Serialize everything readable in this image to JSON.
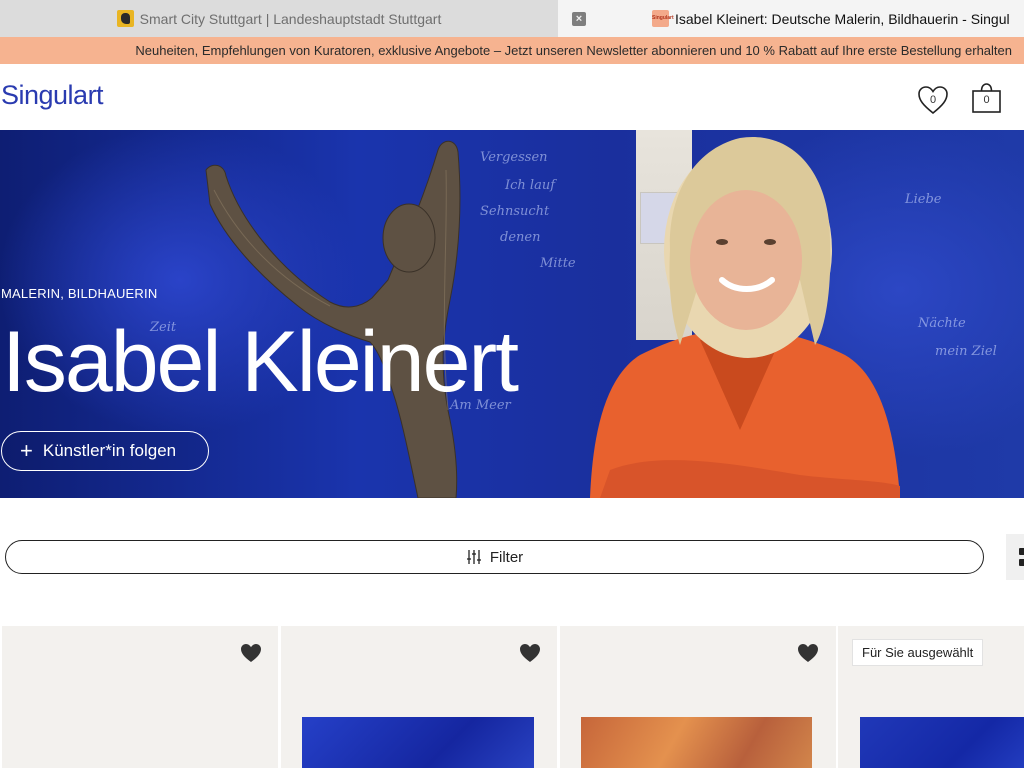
{
  "browser": {
    "tabs": [
      {
        "title": "Smart City Stuttgart | Landeshauptstadt Stuttgart",
        "active": false,
        "favicon": "stuttgart-horse-icon"
      },
      {
        "title": "Isabel Kleinert: Deutsche Malerin, Bildhauerin - Singul",
        "active": true,
        "favicon": "singulart-icon",
        "favicon_text": "Singulart"
      }
    ],
    "close_glyph": "×"
  },
  "promo": {
    "text": "Neuheiten, Empfehlungen von Kuratoren, exklusive Angebote – Jetzt unseren Newsletter abonnieren und 10 % Rabatt auf Ihre erste Bestellung erhalten",
    "background": "#f6b390"
  },
  "header": {
    "logo": "Singulart",
    "logo_color": "#2a3bb0",
    "wishlist_count": "0",
    "cart_count": "0"
  },
  "hero": {
    "subtitle": "MALERIN, BILDHAUERIN",
    "title": "Isabel Kleinert",
    "follow_icon": "+",
    "follow_label": "Künstler*in folgen",
    "scribbles": [
      "Vergessen",
      "Ich lauf",
      "Sehnsucht",
      "denen",
      "Mitte",
      "Liebe",
      "Nächte",
      "mein Ziel",
      "Am Meer",
      "Zeit"
    ]
  },
  "filter": {
    "label": "Filter"
  },
  "products": [
    {
      "favorite": true,
      "badge": "",
      "art_color": ""
    },
    {
      "favorite": true,
      "badge": "",
      "art_color": "#1c36b5"
    },
    {
      "favorite": true,
      "badge": "",
      "art_color": "#d5703a"
    },
    {
      "favorite": false,
      "badge": "Für Sie ausgewählt",
      "art_color": "#1a34b8"
    }
  ]
}
